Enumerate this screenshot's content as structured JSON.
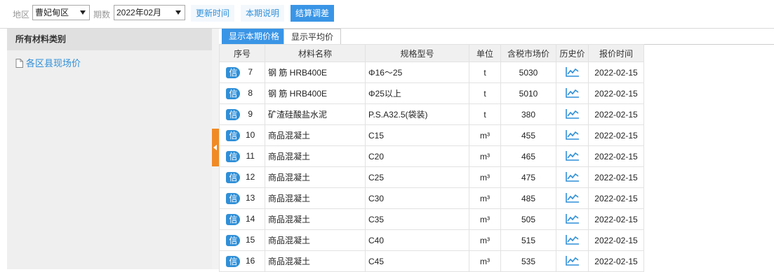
{
  "toolbar": {
    "region_label": "地区",
    "region_value": "曹妃甸区",
    "period_label": "期数",
    "period_value": "2022年02月",
    "update_time_label": "更新时间",
    "period_note_label": "本期说明",
    "settlement_label": "结算调差"
  },
  "sidebar": {
    "header": "所有材料类别",
    "item": "各区县现场价"
  },
  "tabs": {
    "current": "显示本期价格",
    "average": "显示平均价"
  },
  "table": {
    "headers": [
      "序号",
      "材料名称",
      "规格型号",
      "单位",
      "含税市场价",
      "历史价",
      "报价时间"
    ],
    "badge": "信",
    "rows": [
      {
        "seq": "7",
        "name": "钢 筋 HRB400E",
        "spec": "Φ16～25",
        "unit": "t",
        "price": "5030",
        "date": "2022-02-15"
      },
      {
        "seq": "8",
        "name": "钢 筋 HRB400E",
        "spec": "Φ25以上",
        "unit": "t",
        "price": "5010",
        "date": "2022-02-15"
      },
      {
        "seq": "9",
        "name": "矿渣硅酸盐水泥",
        "spec": "P.S.A32.5(袋装)",
        "unit": "t",
        "price": "380",
        "date": "2022-02-15"
      },
      {
        "seq": "10",
        "name": "商品混凝土",
        "spec": "C15",
        "unit": "m³",
        "price": "455",
        "date": "2022-02-15"
      },
      {
        "seq": "11",
        "name": "商品混凝土",
        "spec": "C20",
        "unit": "m³",
        "price": "465",
        "date": "2022-02-15"
      },
      {
        "seq": "12",
        "name": "商品混凝土",
        "spec": "C25",
        "unit": "m³",
        "price": "475",
        "date": "2022-02-15"
      },
      {
        "seq": "13",
        "name": "商品混凝土",
        "spec": "C30",
        "unit": "m³",
        "price": "485",
        "date": "2022-02-15"
      },
      {
        "seq": "14",
        "name": "商品混凝土",
        "spec": "C35",
        "unit": "m³",
        "price": "505",
        "date": "2022-02-15"
      },
      {
        "seq": "15",
        "name": "商品混凝土",
        "spec": "C40",
        "unit": "m³",
        "price": "515",
        "date": "2022-02-15"
      },
      {
        "seq": "16",
        "name": "商品混凝土",
        "spec": "C45",
        "unit": "m³",
        "price": "535",
        "date": "2022-02-15"
      }
    ]
  },
  "colors": {
    "accent": "#3a95e6",
    "link": "#2f8fd8",
    "splitter_handle": "#f08a24"
  },
  "icons": {
    "history": "line-chart-icon",
    "sidebar_item": "document-icon",
    "badge": "credit-badge-icon"
  }
}
